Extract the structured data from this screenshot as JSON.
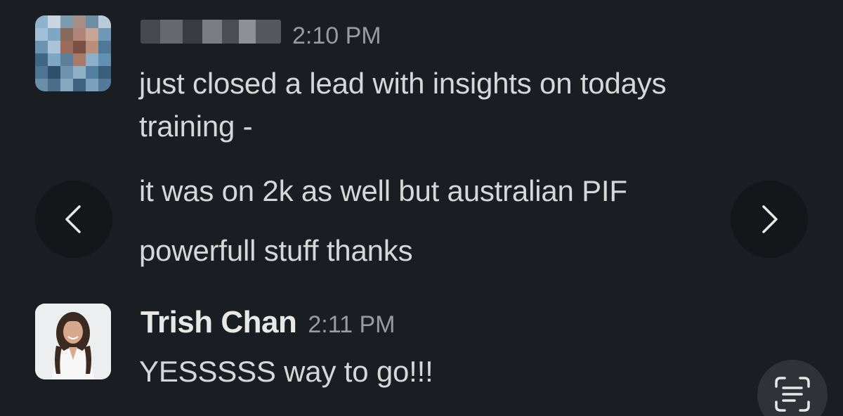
{
  "messages": [
    {
      "author": "",
      "author_obscured": true,
      "time": "2:10 PM",
      "lines": [
        "just closed a lead with insights on todays",
        "training -",
        "it was on 2k as well but australian PIF",
        "powerfull stuff thanks"
      ]
    },
    {
      "author": "Trish Chan",
      "time": "2:11 PM",
      "lines": [
        "YESSSSS way to go!!!"
      ]
    }
  ],
  "icons": {
    "prev": "chevron-left-icon",
    "next": "chevron-right-icon",
    "scan": "live-text-scan-icon"
  },
  "colors": {
    "background": "#1a1d21",
    "text": "#d6d7d9",
    "timestamp": "#9a9b9e",
    "nav_button": "#141619"
  }
}
